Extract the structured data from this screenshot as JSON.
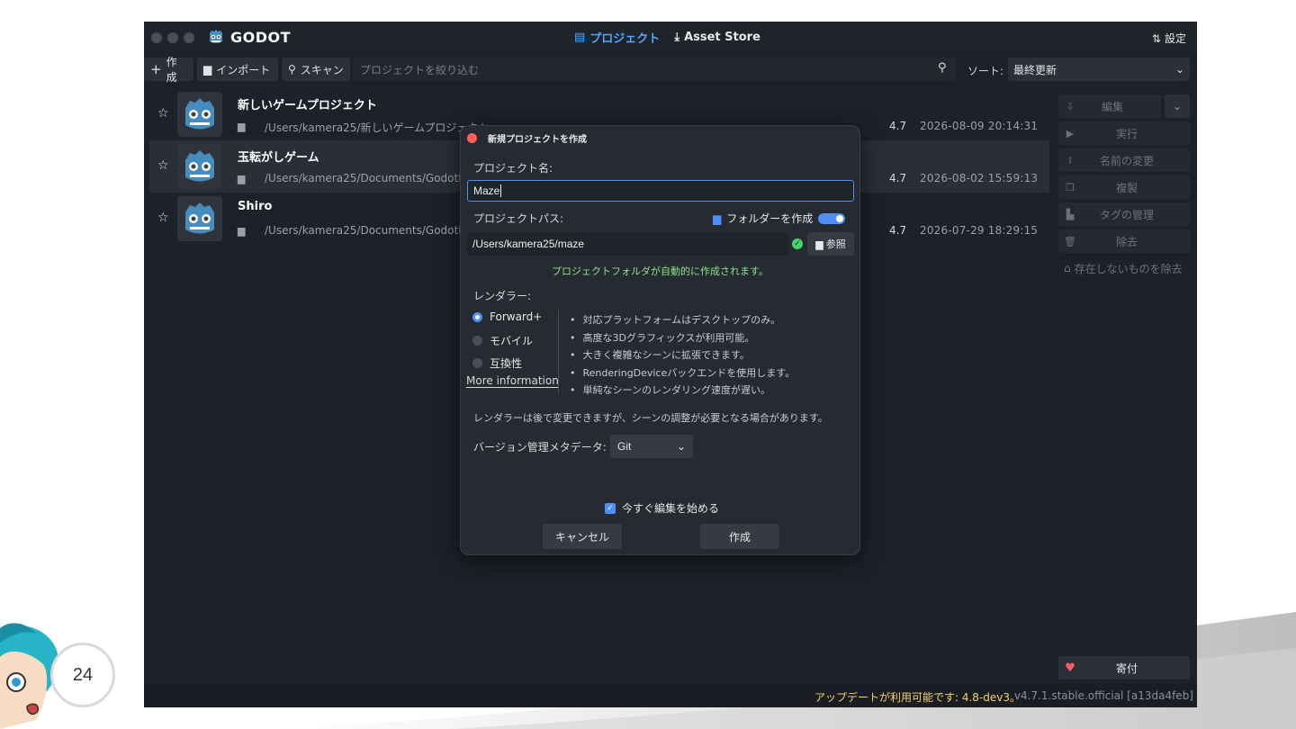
{
  "slide": {
    "page_number": "24"
  },
  "app": {
    "brand": "GODOT",
    "tabs": [
      {
        "label": "プロジェクト",
        "icon": "project-list-icon",
        "active": true
      },
      {
        "label": "Asset Store",
        "icon": "download-icon",
        "active": false
      }
    ],
    "settings_label": "設定",
    "toolbar": {
      "create_label": "作成",
      "import_label": "インポート",
      "scan_label": "スキャン",
      "filter_placeholder": "プロジェクトを絞り込む",
      "sort_label": "ソート:",
      "sort_value": "最終更新"
    },
    "projects": [
      {
        "name": "新しいゲームプロジェクト",
        "path": "/Users/kamera25/新しいゲームプロジェクト",
        "version": "4.7",
        "date": "2026-08-09 20:14:31"
      },
      {
        "name": "玉転がしゲーム",
        "path": "/Users/kamera25/Documents/GodotProjects",
        "version": "4.7",
        "date": "2026-08-02 15:59:13"
      },
      {
        "name": "Shiro",
        "path": "/Users/kamera25/Documents/GodotProjects",
        "version": "4.7",
        "date": "2026-07-29 18:29:15"
      }
    ],
    "sidebar": {
      "edit": "編集",
      "run": "実行",
      "rename": "名前の変更",
      "duplicate": "複製",
      "manage_tags": "タグの管理",
      "remove": "除去",
      "remove_missing": "存在しないものを除去",
      "donate": "寄付"
    },
    "status": {
      "update": "アップデートが利用可能です: 4.8-dev3。",
      "version": "v4.7.1.stable.official [a13da4feb]"
    },
    "colors": {
      "accent": "#4f8ff7",
      "background": "#1d2129",
      "update_text": "#f5d36b",
      "ok_green": "#8be38d"
    }
  },
  "dialog": {
    "title": "新規プロジェクトを作成",
    "project_name_label": "プロジェクト名:",
    "project_name_value": "Maze",
    "project_path_label": "プロジェクトパス:",
    "create_folder_label": "フォルダーを作成",
    "create_folder_on": true,
    "project_path_value": "/Users/kamera25/maze",
    "browse_label": "参照",
    "auto_folder_note": "プロジェクトフォルダが自動的に作成されます。",
    "renderer_label": "レンダラー:",
    "renderers": [
      {
        "label": "Forward+",
        "selected": true
      },
      {
        "label": "モバイル",
        "selected": false
      },
      {
        "label": "互換性",
        "selected": false
      }
    ],
    "more_info": "More information",
    "renderer_features": [
      "対応プラットフォームはデスクトップのみ。",
      "高度な3Dグラフィックスが利用可能。",
      "大きく複雑なシーンに拡張できます。",
      "RenderingDeviceバックエンドを使用します。",
      "単純なシーンのレンダリング速度が遅い。"
    ],
    "renderer_note": "レンダラーは後で変更できますが、シーンの調整が必要となる場合があります。",
    "vcs_label": "バージョン管理メタデータ:",
    "vcs_value": "Git",
    "edit_now_label": "今すぐ編集を始める",
    "edit_now_checked": true,
    "cancel_label": "キャンセル",
    "create_label": "作成"
  }
}
